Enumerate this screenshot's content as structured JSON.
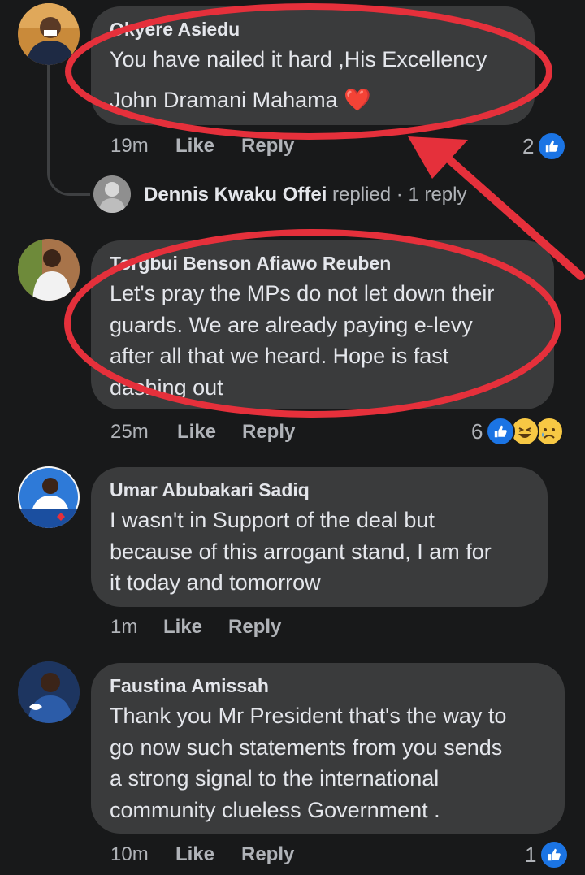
{
  "comments": [
    {
      "author": "Okyere Asiedu",
      "lines": [
        "You have nailed it hard ,His Excellency",
        "John Dramani Mahama"
      ],
      "heart": "❤️",
      "time": "19m",
      "like": "Like",
      "reply": "Reply",
      "reaction_count": "2"
    },
    {
      "author": "Torgbui Benson Afiawo Reuben",
      "lines": [
        "Let's pray the MPs do not let down their",
        "guards. We are already paying e-levy",
        "after all that we heard. Hope is fast",
        "dashing out"
      ],
      "time": "25m",
      "like": "Like",
      "reply": "Reply",
      "reaction_count": "6"
    },
    {
      "author": "Umar Abubakari Sadiq",
      "lines": [
        "I wasn't in Support of the deal but",
        "because of this arrogant stand, I am for",
        "it today and tomorrow"
      ],
      "time": "1m",
      "like": "Like",
      "reply": "Reply"
    },
    {
      "author": "Faustina Amissah",
      "lines": [
        "Thank you Mr President that's the way to",
        "go now such statements from you sends",
        "a strong signal to the international",
        "community clueless Government ."
      ],
      "time": "10m",
      "like": "Like",
      "reply": "Reply",
      "reaction_count": "1"
    }
  ],
  "reply_thread": {
    "name": "Dennis Kwaku Offei",
    "action": "replied",
    "separator": "·",
    "count": "1 reply"
  },
  "colors": {
    "background": "#18191a",
    "bubble": "#3a3b3c",
    "text": "#e4e6eb",
    "meta": "#b0b3b8",
    "like_blue": "#1b74e4",
    "annotation_red": "#e5303b"
  },
  "annotations": [
    "red-ellipse",
    "red-ellipse",
    "red-arrow"
  ]
}
